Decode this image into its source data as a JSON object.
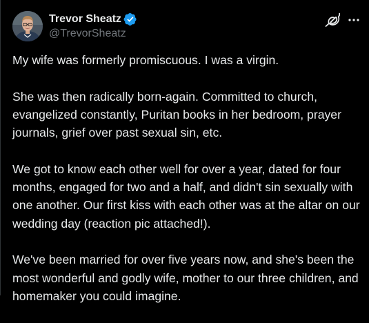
{
  "author": {
    "display_name": "Trevor Sheatz",
    "handle": "@TrevorSheatz",
    "verified": true,
    "verified_icon": "verified-badge-icon",
    "avatar": "profile-avatar"
  },
  "actions": {
    "grok_icon": "grok-icon",
    "more_icon": "more-options-icon"
  },
  "post": {
    "paragraphs": [
      "My wife was formerly promiscuous. I was a virgin.",
      "She was then radically born-again. Committed to church, evangelized constantly, Puritan books in her bedroom, prayer journals, grief over past sexual sin, etc.",
      "We got to know each other well for over a year, dated for four months, engaged for two and a half, and didn't sin sexually with one another. Our first kiss with each other was at the altar on our wedding day (reaction pic attached!).",
      "We've been married for over five years now, and she's been the most wonderful and godly wife, mother to our three children, and homemaker you could imagine."
    ]
  },
  "colors": {
    "background": "#000000",
    "text_primary": "#e7e9ea",
    "text_secondary": "#71767b",
    "verified_blue": "#1d9bf0"
  }
}
